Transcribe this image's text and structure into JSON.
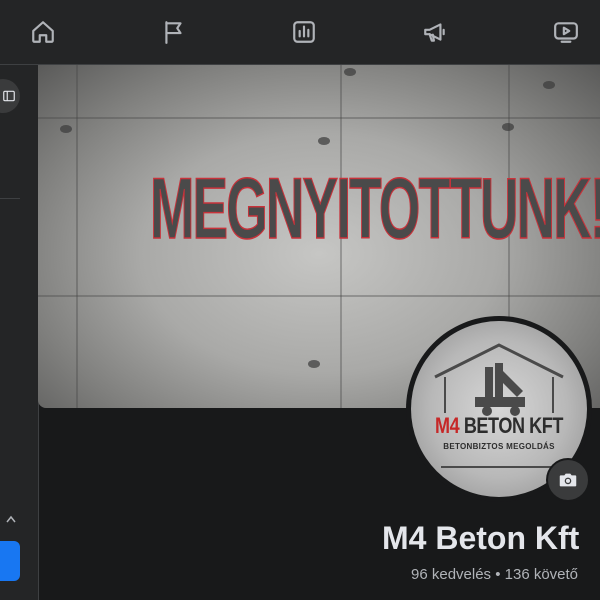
{
  "nav": {
    "items": [
      {
        "name": "home",
        "icon": "home-icon"
      },
      {
        "name": "pages",
        "icon": "flag-icon"
      },
      {
        "name": "insights",
        "icon": "bar-chart-icon"
      },
      {
        "name": "ads",
        "icon": "megaphone-icon"
      },
      {
        "name": "watch",
        "icon": "video-play-icon"
      }
    ]
  },
  "cover": {
    "headline": "MEGNYITOTTUNK!!"
  },
  "profile": {
    "logo_prefix": "M4",
    "logo_suffix": " BETON KFT",
    "logo_tagline": "BETONBIZTOS MEGOLDÁS",
    "name": "M4 Beton Kft",
    "stats": "96 kedvelés • 136 követő"
  },
  "colors": {
    "background": "#18191a",
    "panel": "#242526",
    "accent": "#1877f2",
    "logo_red": "#c62828"
  }
}
